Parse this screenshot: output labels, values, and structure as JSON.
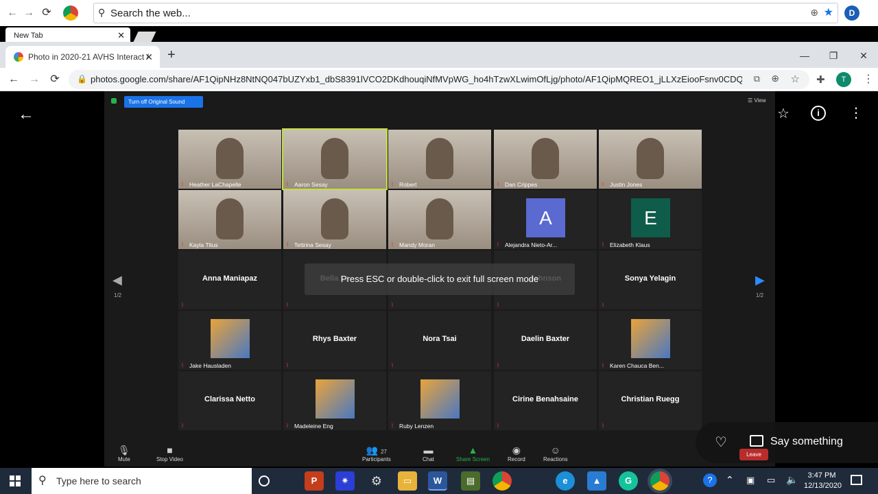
{
  "outer_browser": {
    "search_placeholder": "Search the web...",
    "tab_label": "New Tab"
  },
  "inner_browser": {
    "tab_title": "Photo in 2020-21 AVHS Interact /",
    "url": "photos.google.com/share/AF1QipNHz8NtNQ047bUZYxb1_dbS8391lVCO2DKdhouqiNfMVpWG_ho4hTzwXLwimOfLjg/photo/AF1QipMQREO1_jLLXzEiooFsnv0CDQ...",
    "profile_initial": "T"
  },
  "zoom": {
    "sound_button": "Turn off Original Sound",
    "view_label": "View",
    "page_left": "1/2",
    "page_right": "1/2",
    "toast": "Press ESC or double-click to exit full screen mode",
    "participants": [
      {
        "name": "Heather LaChapelle",
        "kind": "video"
      },
      {
        "name": "Aaron Sesay",
        "kind": "video"
      },
      {
        "name": "Robert",
        "kind": "video"
      },
      {
        "name": "Dan Crippes",
        "kind": "video"
      },
      {
        "name": "Justin Jones",
        "kind": "video"
      },
      {
        "name": "Kayla Titus",
        "kind": "video"
      },
      {
        "name": "Tettrina Sesay",
        "kind": "video"
      },
      {
        "name": "Mandy Moran",
        "kind": "video"
      },
      {
        "name": "Alejandra Nieto-Ar...",
        "kind": "avatar",
        "initial": "A",
        "color": "#5b6ad0"
      },
      {
        "name": "Elizabeth Klaus",
        "kind": "avatar",
        "initial": "E",
        "color": "#0f5c4a"
      },
      {
        "name": "Anna Maniapaz",
        "kind": "text"
      },
      {
        "name": "Bella Le",
        "kind": "text"
      },
      {
        "name": "",
        "kind": "text"
      },
      {
        "name": "Johnson",
        "kind": "text"
      },
      {
        "name": "Sonya Yelagin",
        "kind": "text"
      },
      {
        "name": "Jake Hausladen",
        "kind": "image"
      },
      {
        "name": "Rhys Baxter",
        "kind": "text"
      },
      {
        "name": "Nora Tsai",
        "kind": "text"
      },
      {
        "name": "Daelin Baxter",
        "kind": "text"
      },
      {
        "name": "Karen Chauca Ben...",
        "kind": "image"
      },
      {
        "name": "Clarissa Netto",
        "kind": "text"
      },
      {
        "name": "Madeleine Eng",
        "kind": "image"
      },
      {
        "name": "Ruby Lenzen",
        "kind": "image"
      },
      {
        "name": "Cirine Benahsaine",
        "kind": "text"
      },
      {
        "name": "Christian Ruegg",
        "kind": "text"
      }
    ],
    "controls": {
      "mute": "Mute",
      "stop_video": "Stop Video",
      "participants": "Participants",
      "participant_count": "27",
      "chat": "Chat",
      "share_screen": "Share Screen",
      "record": "Record",
      "reactions": "Reactions",
      "leave": "Leave"
    }
  },
  "photo_actions": {
    "say_something": "Say something"
  },
  "taskbar": {
    "search_placeholder": "Type here to search",
    "time": "3:47 PM",
    "date": "12/13/2020"
  }
}
